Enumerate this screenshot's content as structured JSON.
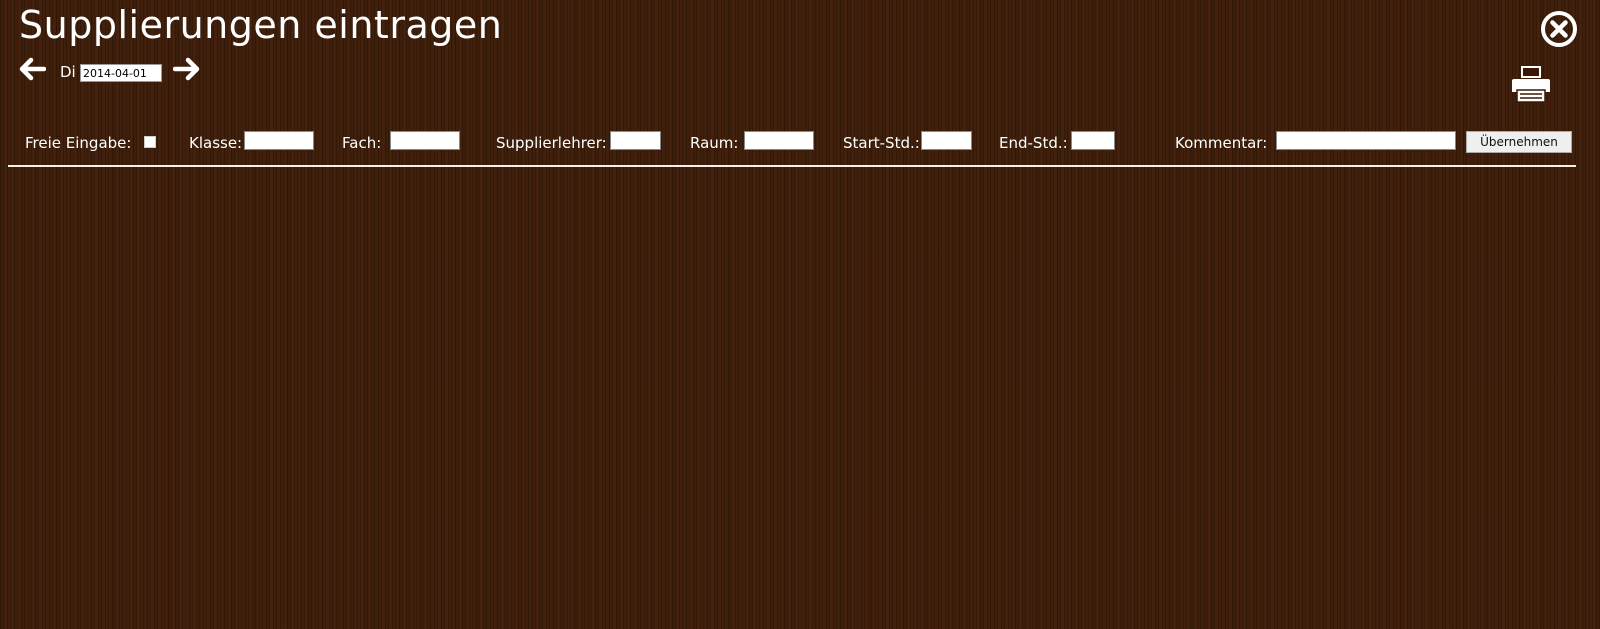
{
  "page": {
    "title": "Supplierungen eintragen"
  },
  "nav": {
    "prev_icon": "arrow-left-icon",
    "next_icon": "arrow-right-icon",
    "day_label": "Di",
    "date_value": "2014-04-01"
  },
  "actions": {
    "close_icon": "close-circle-icon",
    "print_icon": "printer-icon"
  },
  "form": {
    "free_input_label": "Freie Eingabe:",
    "free_input_checked": false,
    "class_label": "Klasse:",
    "class_value": "",
    "subject_label": "Fach:",
    "subject_value": "",
    "substitute_teacher_label": "Supplierlehrer:",
    "substitute_teacher_value": "",
    "room_label": "Raum:",
    "room_value": "",
    "start_lesson_label": "Start-Std.:",
    "start_lesson_value": "",
    "end_lesson_label": "End-Std.:",
    "end_lesson_value": "",
    "comment_label": "Kommentar:",
    "comment_value": "",
    "submit_label": "Übernehmen"
  },
  "colors": {
    "background": "#3a1a06",
    "text": "#ffffff",
    "divider": "#f5f0ea"
  }
}
